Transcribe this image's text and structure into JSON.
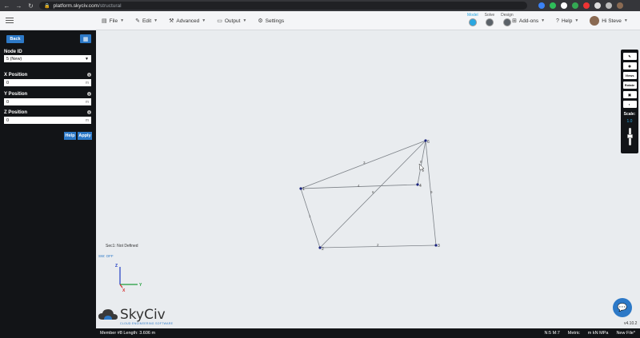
{
  "browser": {
    "url_host": "platform.skyciv.com",
    "url_path": "/structural"
  },
  "menu": {
    "file": "File",
    "edit": "Edit",
    "advanced": "Advanced",
    "output": "Output",
    "settings": "Settings",
    "addons": "Add-ons",
    "help": "Help",
    "user": "Hi Steve"
  },
  "modes": {
    "model": "Model",
    "solve": "Solve",
    "design": "Design"
  },
  "sidebar": {
    "back": "Back",
    "node_id_label": "Node ID",
    "node_id_value": "5 (New)",
    "x_label": "X Position",
    "x_value": "0",
    "y_label": "Y Position",
    "y_value": "0",
    "z_label": "Z Position",
    "z_value": "0",
    "unit": "m",
    "help": "Help",
    "apply": "Apply"
  },
  "toolbar": {
    "views": "Views",
    "rotate": "Rotate",
    "scale_label": "Scale:",
    "scale_value": "1.0"
  },
  "canvas": {
    "section_text": "Sec1: Not Defined",
    "sw_text": "SW: OFF",
    "axis_x": "X",
    "axis_y": "Y",
    "axis_z": "Z",
    "nodes": [
      {
        "id": "1"
      },
      {
        "id": "2"
      },
      {
        "id": "3"
      },
      {
        "id": "4"
      },
      {
        "id": "6"
      }
    ],
    "members": [
      {
        "id": "1"
      },
      {
        "id": "2"
      },
      {
        "id": "3"
      },
      {
        "id": "4"
      },
      {
        "id": "6"
      },
      {
        "id": "8"
      },
      {
        "id": "9"
      }
    ]
  },
  "logo": {
    "brand": "SkyCiv",
    "tagline": "CLOUD ENGINEERING SOFTWARE"
  },
  "version": "v4.10.2",
  "status": {
    "member_info": "Member #8 Length: 3.606 m",
    "counts": "N:5  M:7",
    "units": "Metric",
    "unit_set": "m  kN  MPa",
    "file": "New File*"
  },
  "colors": {
    "accent": "#2d79c7",
    "active_mode": "#2aa7e1",
    "panel": "#121417"
  }
}
